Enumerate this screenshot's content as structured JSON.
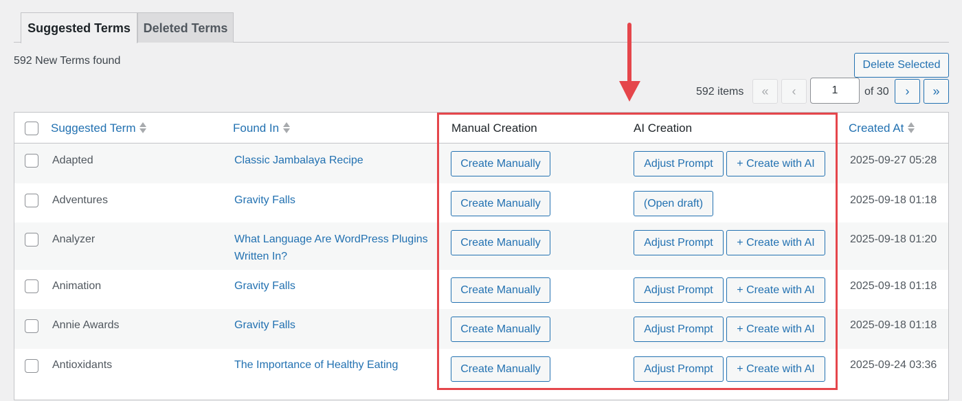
{
  "tabs": [
    {
      "label": "Suggested Terms",
      "active": true
    },
    {
      "label": "Deleted Terms",
      "active": false
    }
  ],
  "found_text": "592 New Terms found",
  "delete_label": "Delete Selected",
  "pagination": {
    "items_text": "592 items",
    "first": "«",
    "prev": "‹",
    "current_page": "1",
    "of_text": "of 30",
    "next": "›",
    "last": "»"
  },
  "columns": {
    "term": "Suggested Term",
    "found": "Found In",
    "manual": "Manual Creation",
    "ai": "AI Creation",
    "created": "Created At"
  },
  "rows": [
    {
      "term": "Adapted",
      "found": "Classic Jambalaya Recipe",
      "manual": "Create Manually",
      "ai_primary": "Adjust Prompt",
      "ai_secondary": "+ Create with AI",
      "created": "2025-09-27 05:28"
    },
    {
      "term": "Adventures",
      "found": "Gravity Falls",
      "manual": "Create Manually",
      "ai_primary": "(Open draft)",
      "ai_secondary": null,
      "created": "2025-09-18 01:18"
    },
    {
      "term": "Analyzer",
      "found": "What Language Are WordPress Plugins Written In?",
      "manual": "Create Manually",
      "ai_primary": "Adjust Prompt",
      "ai_secondary": "+ Create with AI",
      "created": "2025-09-18 01:20"
    },
    {
      "term": "Animation",
      "found": "Gravity Falls",
      "manual": "Create Manually",
      "ai_primary": "Adjust Prompt",
      "ai_secondary": "+ Create with AI",
      "created": "2025-09-18 01:18"
    },
    {
      "term": "Annie Awards",
      "found": "Gravity Falls",
      "manual": "Create Manually",
      "ai_primary": "Adjust Prompt",
      "ai_secondary": "+ Create with AI",
      "created": "2025-09-18 01:18"
    },
    {
      "term": "Antioxidants",
      "found": "The Importance of Healthy Eating",
      "manual": "Create Manually",
      "ai_primary": "Adjust Prompt",
      "ai_secondary": "+ Create with AI",
      "created": "2025-09-24 03:36"
    }
  ],
  "colors": {
    "accent": "#2271b1",
    "highlight": "#e5464b",
    "background": "#f0f0f1"
  }
}
